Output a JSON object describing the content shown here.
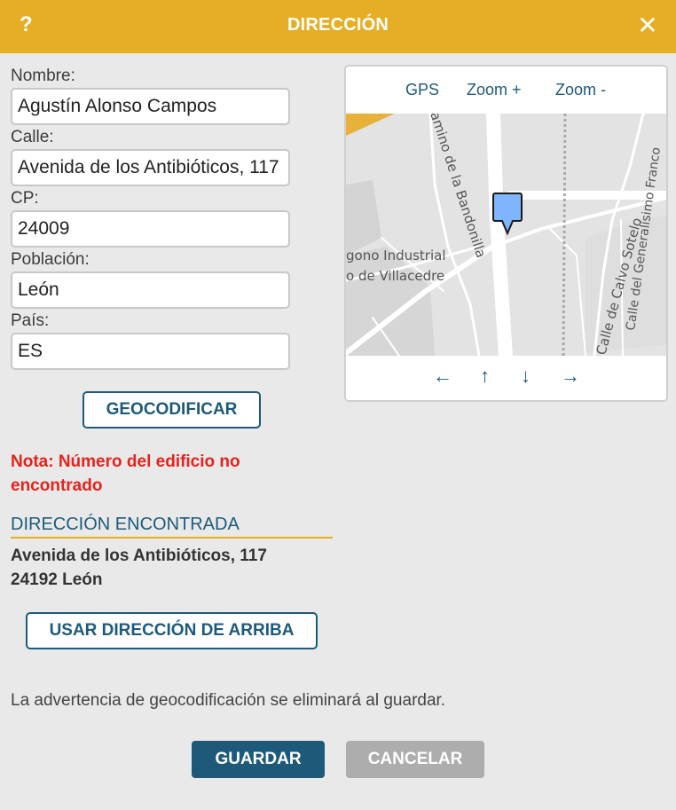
{
  "header": {
    "help_label": "?",
    "title": "DIRECCIÓN",
    "close_label": "✕"
  },
  "form": {
    "name_label": "Nombre:",
    "name_value": "Agustín Alonso Campos",
    "street_label": "Calle:",
    "street_value": "Avenida de los Antibióticos, 117",
    "zip_label": "CP:",
    "zip_value": "24009",
    "city_label": "Población:",
    "city_value": "León",
    "country_label": "País:",
    "country_value": "ES"
  },
  "geocode_button": "GEOCODIFICAR",
  "note": "Nota: Número del edificio no encontrado",
  "found": {
    "heading": "DIRECCIÓN ENCONTRADA",
    "line1": "Avenida de los Antibióticos, 117",
    "line2": "24192 León"
  },
  "use_address_button": "USAR DIRECCIÓN DE ARRIBA",
  "warning": "La advertencia de geocodificación se eliminará al guardar.",
  "footer": {
    "save_label": "GUARDAR",
    "cancel_label": "CANCELAR"
  },
  "map": {
    "gps_label": "GPS",
    "zoom_in_label": "Zoom +",
    "zoom_out_label": "Zoom -",
    "nav_left": "←",
    "nav_up": "↑",
    "nav_down": "↓",
    "nav_right": "→",
    "street_labels": {
      "camino": "amino de la Bandonilla",
      "poligono_1": "gono Industrial",
      "poligono_2": "o de Villacedre",
      "calvo": "Calle de Calvo Sotelo",
      "generalisimo": "Calle del Generalísimo Franco"
    }
  },
  "colors": {
    "header": "#e5ae25",
    "primary": "#1d5a7a",
    "warning_text": "#e8221c",
    "disabled": "#adadad",
    "marker": "#7fb5ff"
  }
}
